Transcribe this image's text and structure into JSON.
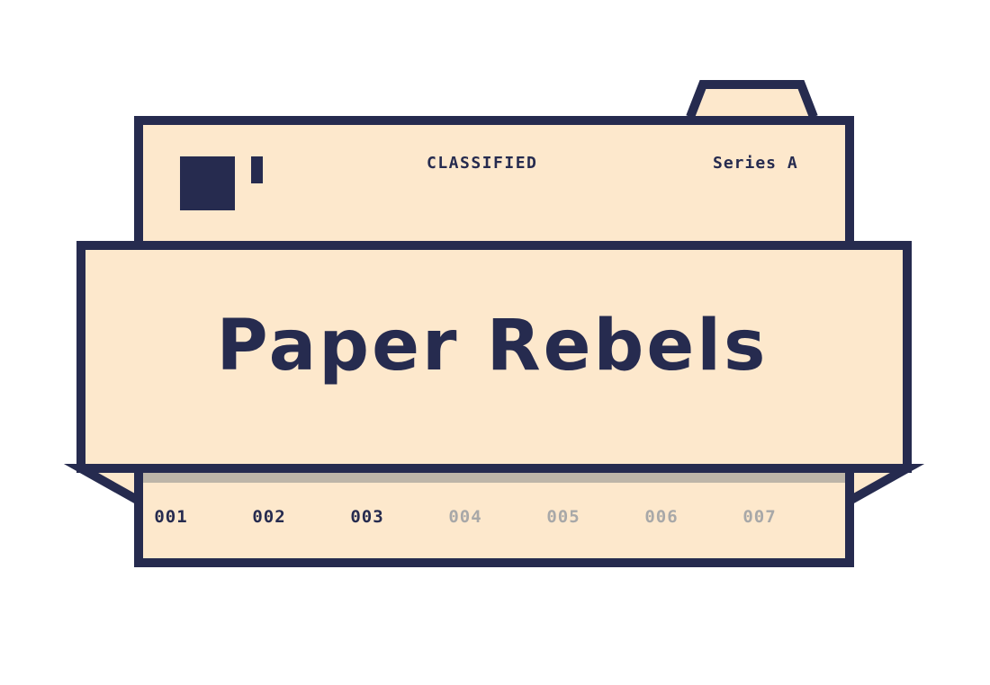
{
  "colors": {
    "navy": "#262b4f",
    "paper": "#fde8cc",
    "shadow": "#bdb5a8",
    "inactive": "#a8a8a8",
    "background": "#ffffff"
  },
  "header": {
    "stamp": "CLASSIFIED",
    "series": "Series A"
  },
  "title": "Paper Rebels",
  "issues": [
    {
      "label": "001",
      "active": true
    },
    {
      "label": "002",
      "active": true
    },
    {
      "label": "003",
      "active": true
    },
    {
      "label": "004",
      "active": false
    },
    {
      "label": "005",
      "active": false
    },
    {
      "label": "006",
      "active": false
    },
    {
      "label": "007",
      "active": false
    }
  ]
}
